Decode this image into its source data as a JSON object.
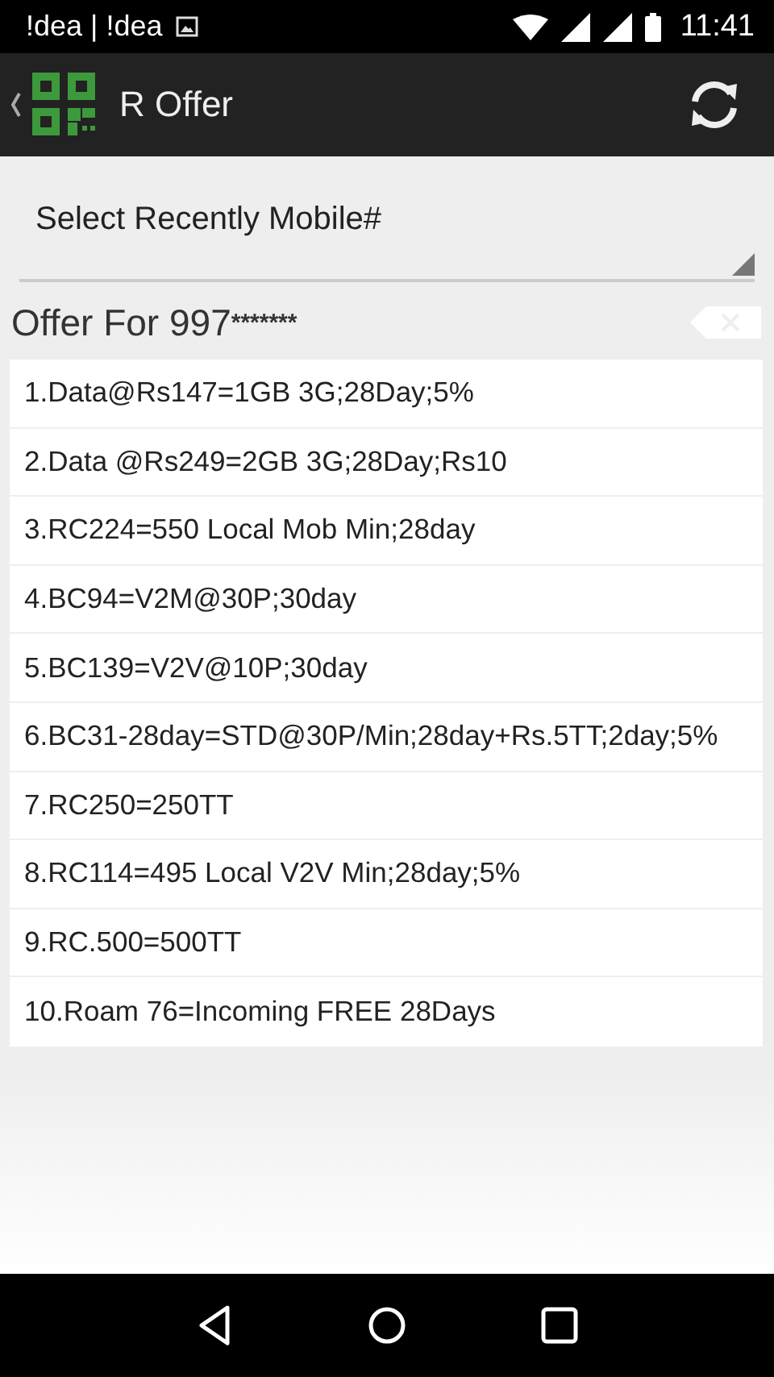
{
  "status_bar": {
    "carrier": "!dea | !dea",
    "time": "11:41"
  },
  "app_bar": {
    "title": "R Offer"
  },
  "spinner": {
    "placeholder": "Select Recently Mobile#"
  },
  "offer_header": {
    "label": "Offer For 997",
    "masked": "*******"
  },
  "offers": [
    {
      "text": "1.Data@Rs147=1GB 3G;28Day;5%"
    },
    {
      "text": "2.Data @Rs249=2GB 3G;28Day;Rs10"
    },
    {
      "text": "3.RC224=550 Local Mob Min;28day"
    },
    {
      "text": "4.BC94=V2M@30P;30day"
    },
    {
      "text": "5.BC139=V2V@10P;30day"
    },
    {
      "text": "6.BC31-28day=STD@30P/Min;28day+Rs.5TT;2day;5%"
    },
    {
      "text": "7.RC250=250TT"
    },
    {
      "text": "8.RC114=495 Local V2V Min;28day;5%"
    },
    {
      "text": "9.RC.500=500TT"
    },
    {
      "text": "10.Roam 76=Incoming FREE 28Days"
    }
  ]
}
